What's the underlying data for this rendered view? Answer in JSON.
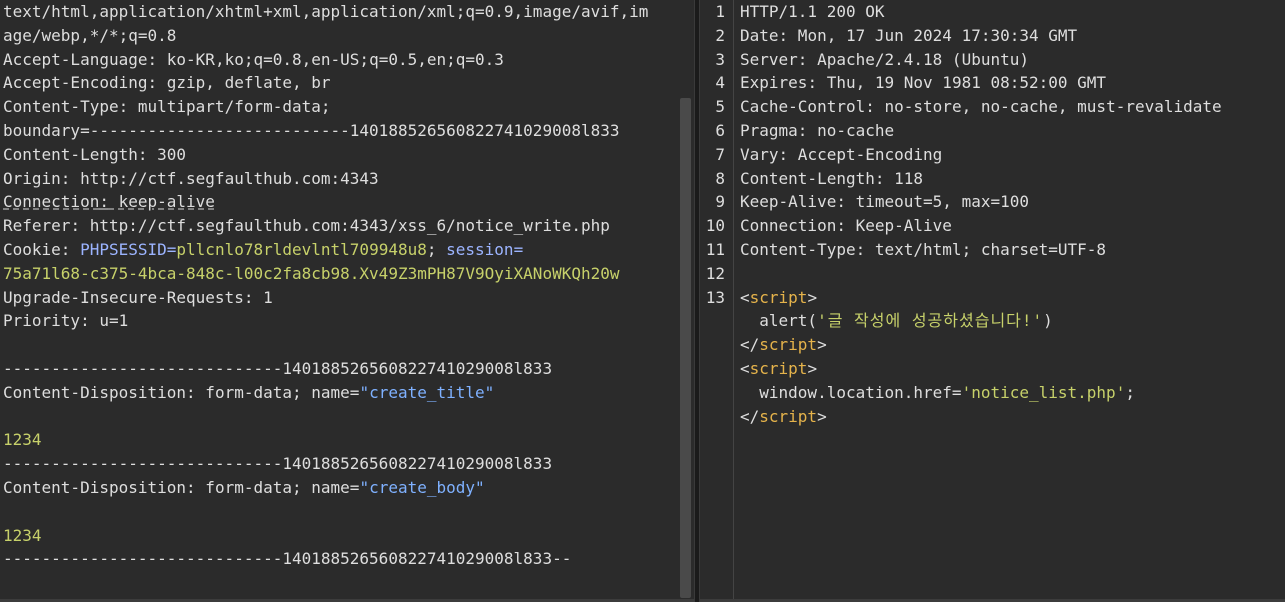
{
  "request": {
    "lines": [
      {
        "type": "plain",
        "text": "text/html,application/xhtml+xml,application/xml;q=0.9,image/avif,im"
      },
      {
        "type": "plain",
        "text": "age/webp,*/*;q=0.8"
      },
      {
        "type": "header",
        "key": "Accept-Language",
        "value": " ko-KR,ko;q=0.8,en-US;q=0.5,en;q=0.3"
      },
      {
        "type": "header",
        "key": "Accept-Encoding",
        "value": " gzip, deflate, br"
      },
      {
        "type": "header",
        "key": "Content-Type",
        "value": " multipart/form-data;"
      },
      {
        "type": "plain",
        "text": "boundary=---------------------------140188526560822741029008l833"
      },
      {
        "type": "header",
        "key": "Content-Length",
        "value": " 300"
      },
      {
        "type": "header",
        "key": "Origin",
        "value": " http://ctf.segfaulthub.com:4343"
      },
      {
        "type": "header_underline",
        "key": "Connection",
        "value": " keep-alive"
      },
      {
        "type": "header",
        "key": "Referer",
        "value": " http://ctf.segfaulthub.com:4343/xss_6/notice_write.php"
      },
      {
        "type": "cookie",
        "key": "Cookie",
        "n1": "PHPSESSID",
        "v1": "pllcnlo78rldevlntl709948u8",
        "n2": "session",
        "sep": "; "
      },
      {
        "type": "yellow",
        "text": "75a71l68-c375-4bca-848c-l00c2fa8cb98.Xv49Z3mPH87V9OyiXANoWKQh20w"
      },
      {
        "type": "header",
        "key": "Upgrade-Insecure-Requests",
        "value": " 1"
      },
      {
        "type": "header",
        "key": "Priority",
        "value": " u=1"
      },
      {
        "type": "plain",
        "text": ""
      },
      {
        "type": "plain",
        "text": "-----------------------------140188526560822741029008l833"
      },
      {
        "type": "disposition",
        "key": "Content-Disposition",
        "value": " form-data; name=",
        "name": "\"create_title\""
      },
      {
        "type": "plain",
        "text": ""
      },
      {
        "type": "yellow",
        "text": "1234"
      },
      {
        "type": "plain",
        "text": "-----------------------------140188526560822741029008l833"
      },
      {
        "type": "disposition",
        "key": "Content-Disposition",
        "value": " form-data; name=",
        "name": "\"create_body\""
      },
      {
        "type": "plain",
        "text": ""
      },
      {
        "type": "yellow",
        "text": "1234"
      },
      {
        "type": "plain",
        "text": "-----------------------------140188526560822741029008l833--"
      }
    ]
  },
  "response": {
    "line_numbers": [
      "1",
      "2",
      "3",
      "4",
      "5",
      "6",
      "7",
      "8",
      "9",
      "10",
      "11",
      "12",
      "13"
    ],
    "status_line": "HTTP/1.1 200 OK",
    "headers": [
      {
        "key": "Date",
        "value": " Mon, 17 Jun 2024 17:30:34 GMT"
      },
      {
        "key": "Server",
        "value": " Apache/2.4.18 (Ubuntu)"
      },
      {
        "key": "Expires",
        "value": " Thu, 19 Nov 1981 08:52:00 GMT"
      },
      {
        "key": "Cache-Control",
        "value": " no-store, no-cache, must-revalidate"
      },
      {
        "key": "Pragma",
        "value": " no-cache"
      },
      {
        "key": "Vary",
        "value": " Accept-Encoding"
      },
      {
        "key": "Content-Length",
        "value": " 118"
      },
      {
        "key": "Keep-Alive",
        "value": " timeout=5, max=100"
      },
      {
        "key": "Connection",
        "value": " Keep-Alive"
      },
      {
        "key": "Content-Type",
        "value": " text/html; charset=UTF-8"
      }
    ],
    "body": {
      "script_tag": "script",
      "alert_prefix": "  alert(",
      "alert_string": "'글 작성에 성공하셨습니다!'",
      "alert_suffix": ")",
      "location_prefix": "  window.location.href=",
      "location_string": "'notice_list.php'",
      "location_suffix": ";"
    }
  }
}
